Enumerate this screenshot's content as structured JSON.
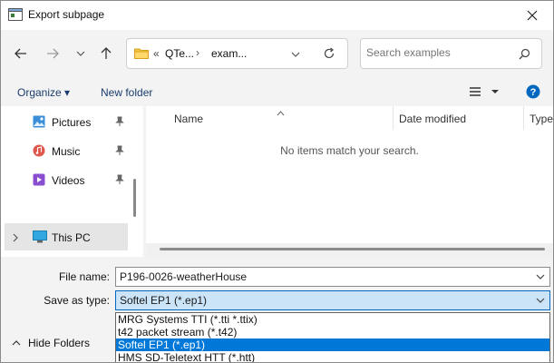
{
  "window": {
    "title": "Export subpage"
  },
  "address": {
    "prefix": "«",
    "crumb1": "QTe...",
    "sep": "›",
    "crumb2": "exam..."
  },
  "search": {
    "placeholder": "Search examples"
  },
  "toolbar": {
    "organize": "Organize ▾",
    "new_folder": "New folder"
  },
  "sidebar": {
    "items": [
      {
        "label": "Pictures",
        "icon": "pictures-icon",
        "pinned": true
      },
      {
        "label": "Music",
        "icon": "music-icon",
        "pinned": true
      },
      {
        "label": "Videos",
        "icon": "videos-icon",
        "pinned": true
      },
      {
        "label": "This PC",
        "icon": "computer-icon",
        "selected": true
      }
    ]
  },
  "columns": {
    "name": "Name",
    "date_modified": "Date modified",
    "type": "Type"
  },
  "empty_message": "No items match your search.",
  "form": {
    "file_name_label": "File name:",
    "file_name_value": "P196-0026-weatherHouse",
    "save_as_label": "Save as type:",
    "save_as_value": "Softel EP1 (*.ep1)",
    "options": [
      "MRG Systems TTI (*.tti *.ttix)",
      "t42 packet stream (*.t42)",
      "Softel EP1 (*.ep1)",
      "HMS SD-Teletext HTT (*.htt)"
    ],
    "highlighted_option": "Softel EP1 (*.ep1)"
  },
  "hide_folders": "Hide Folders",
  "colors": {
    "accent": "#0078d7",
    "help": "#0067c0",
    "selection_bg": "#cce4f7"
  }
}
